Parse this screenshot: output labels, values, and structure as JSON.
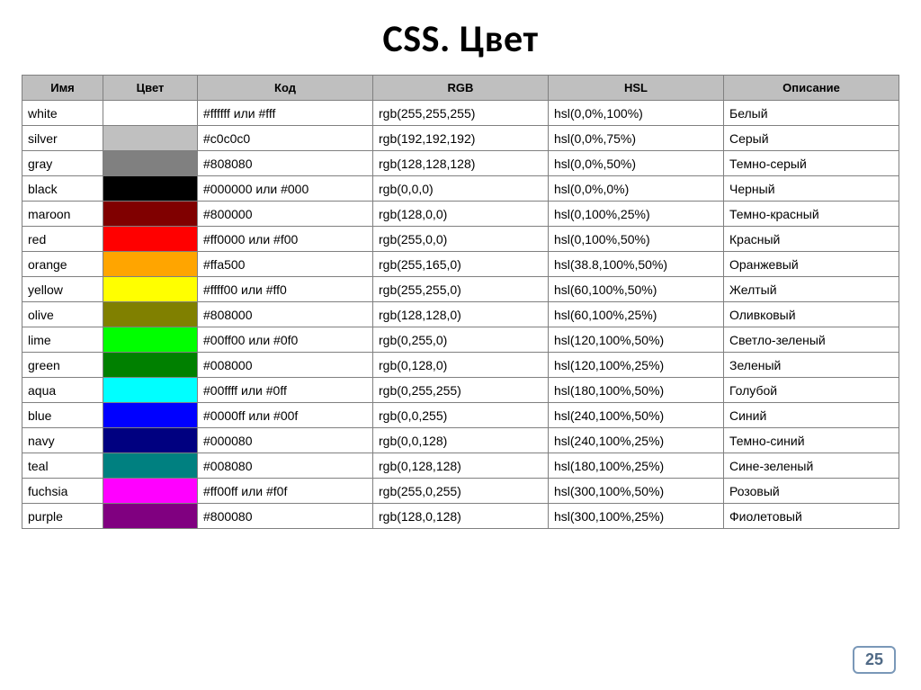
{
  "title": "CSS. Цвет",
  "page_number": "25",
  "headers": {
    "name": "Имя",
    "color": "Цвет",
    "code": "Код",
    "rgb": "RGB",
    "hsl": "HSL",
    "desc": "Описание"
  },
  "rows": [
    {
      "name": "white",
      "swatch": "#ffffff",
      "code": "#ffffff или #fff",
      "rgb": "rgb(255,255,255)",
      "hsl": "hsl(0,0%,100%)",
      "desc": "Белый"
    },
    {
      "name": "silver",
      "swatch": "#c0c0c0",
      "code": "#c0c0c0",
      "rgb": "rgb(192,192,192)",
      "hsl": "hsl(0,0%,75%)",
      "desc": "Серый"
    },
    {
      "name": "gray",
      "swatch": "#808080",
      "code": "#808080",
      "rgb": "rgb(128,128,128)",
      "hsl": "hsl(0,0%,50%)",
      "desc": "Темно-серый"
    },
    {
      "name": "black",
      "swatch": "#000000",
      "code": "#000000 или #000",
      "rgb": "rgb(0,0,0)",
      "hsl": "hsl(0,0%,0%)",
      "desc": "Черный"
    },
    {
      "name": "maroon",
      "swatch": "#800000",
      "code": "#800000",
      "rgb": "rgb(128,0,0)",
      "hsl": "hsl(0,100%,25%)",
      "desc": "Темно-красный"
    },
    {
      "name": "red",
      "swatch": "#ff0000",
      "code": "#ff0000 или #f00",
      "rgb": "rgb(255,0,0)",
      "hsl": "hsl(0,100%,50%)",
      "desc": "Красный"
    },
    {
      "name": "orange",
      "swatch": "#ffa500",
      "code": "#ffa500",
      "rgb": "rgb(255,165,0)",
      "hsl": "hsl(38.8,100%,50%)",
      "desc": "Оранжевый"
    },
    {
      "name": "yellow",
      "swatch": "#ffff00",
      "code": "#ffff00 или #ff0",
      "rgb": "rgb(255,255,0)",
      "hsl": "hsl(60,100%,50%)",
      "desc": "Желтый"
    },
    {
      "name": "olive",
      "swatch": "#808000",
      "code": "#808000",
      "rgb": "rgb(128,128,0)",
      "hsl": "hsl(60,100%,25%)",
      "desc": "Оливковый"
    },
    {
      "name": "lime",
      "swatch": "#00ff00",
      "code": "#00ff00 или #0f0",
      "rgb": "rgb(0,255,0)",
      "hsl": "hsl(120,100%,50%)",
      "desc": "Светло-зеленый"
    },
    {
      "name": "green",
      "swatch": "#008000",
      "code": "#008000",
      "rgb": "rgb(0,128,0)",
      "hsl": "hsl(120,100%,25%)",
      "desc": "Зеленый"
    },
    {
      "name": "aqua",
      "swatch": "#00ffff",
      "code": "#00ffff или #0ff",
      "rgb": "rgb(0,255,255)",
      "hsl": "hsl(180,100%,50%)",
      "desc": "Голубой"
    },
    {
      "name": "blue",
      "swatch": "#0000ff",
      "code": "#0000ff или #00f",
      "rgb": "rgb(0,0,255)",
      "hsl": "hsl(240,100%,50%)",
      "desc": "Синий"
    },
    {
      "name": "navy",
      "swatch": "#000080",
      "code": "#000080",
      "rgb": "rgb(0,0,128)",
      "hsl": "hsl(240,100%,25%)",
      "desc": "Темно-синий"
    },
    {
      "name": "teal",
      "swatch": "#008080",
      "code": "#008080",
      "rgb": "rgb(0,128,128)",
      "hsl": "hsl(180,100%,25%)",
      "desc": "Сине-зеленый"
    },
    {
      "name": "fuchsia",
      "swatch": "#ff00ff",
      "code": "#ff00ff или #f0f",
      "rgb": "rgb(255,0,255)",
      "hsl": "hsl(300,100%,50%)",
      "desc": "Розовый"
    },
    {
      "name": "purple",
      "swatch": "#800080",
      "code": "#800080",
      "rgb": "rgb(128,0,128)",
      "hsl": "hsl(300,100%,25%)",
      "desc": "Фиолетовый"
    }
  ]
}
